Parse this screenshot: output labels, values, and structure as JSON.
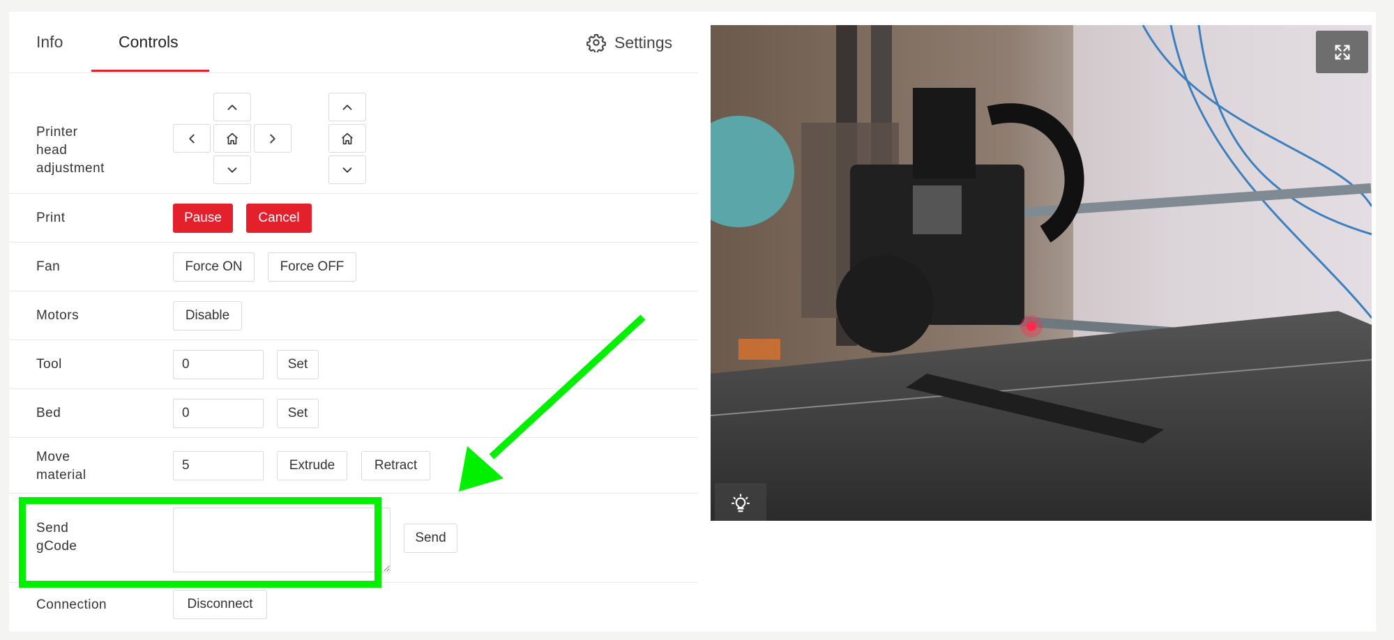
{
  "tabs": {
    "info": "Info",
    "controls": "Controls",
    "settings": "Settings"
  },
  "rows": {
    "head": {
      "label": "Printer\nhead\nadjustment"
    },
    "print": {
      "label": "Print",
      "pause": "Pause",
      "cancel": "Cancel"
    },
    "fan": {
      "label": "Fan",
      "on": "Force ON",
      "off": "Force OFF"
    },
    "motors": {
      "label": "Motors",
      "disable": "Disable"
    },
    "tool": {
      "label": "Tool",
      "value": "0",
      "set": "Set"
    },
    "bed": {
      "label": "Bed",
      "value": "0",
      "set": "Set"
    },
    "move": {
      "label": "Move\nmaterial",
      "value": "5",
      "extrude": "Extrude",
      "retract": "Retract"
    },
    "gcode": {
      "label": "Send\ngCode",
      "value": "",
      "send": "Send"
    },
    "connection": {
      "label": "Connection",
      "disconnect": "Disconnect"
    }
  },
  "colors": {
    "accent": "#e4202c",
    "annotation": "#00f000"
  },
  "icons": {
    "settings": "gear-icon",
    "jog_xy": [
      "chevron-up-icon",
      "chevron-left-icon",
      "home-icon",
      "chevron-right-icon",
      "chevron-down-icon"
    ],
    "jog_z": [
      "chevron-up-icon",
      "home-icon",
      "chevron-down-icon"
    ],
    "camera": [
      "fullscreen-icon",
      "light-bulb-icon"
    ]
  }
}
